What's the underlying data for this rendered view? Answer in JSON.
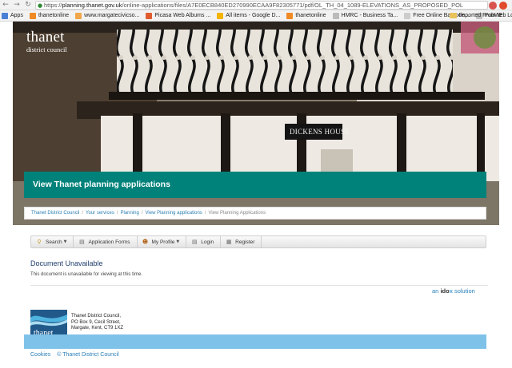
{
  "browser": {
    "url_scheme": "https://",
    "url_host": "planning.thanet.gov.uk",
    "url_path": "/online-applications/files/A7E0ECB840ED270990ECAA9F82305771/pdf/OL_TH_04_1089-ELEVATIONS_AS_PROPOSED_POL",
    "bookmarks": [
      {
        "label": "Apps",
        "color": "#4a7fd6"
      },
      {
        "label": "thanetonline",
        "color": "#f08a24"
      },
      {
        "label": "www.margatecivicso...",
        "color": "#f0a64a"
      },
      {
        "label": "Picasa Web Albums ...",
        "color": "#e05c2f"
      },
      {
        "label": "All items - Google D...",
        "color": "#f4b400"
      },
      {
        "label": "thanetonline",
        "color": "#f08a24"
      },
      {
        "label": "HMRC - Business Ta...",
        "color": "#bbbbbb"
      },
      {
        "label": "Free Online Barcode...",
        "color": "#cccccc"
      },
      {
        "label": "PubWeb Logon",
        "color": "#c0c0c0"
      }
    ],
    "bookmark_folder": "Imported From IE"
  },
  "brand": {
    "title": "thanet",
    "subtitle": "district council"
  },
  "hero": {
    "sign_text": "DICKENS HOUSE"
  },
  "banner": {
    "title": "View Thanet planning applications"
  },
  "breadcrumb": {
    "links": [
      "Thanet District Council",
      "Your services",
      "Planning",
      "View Planning applications"
    ],
    "current": "View Planning Applications"
  },
  "toolbar": {
    "items": [
      {
        "label": "Search",
        "icon": "search-icon",
        "dropdown": true
      },
      {
        "label": "Application Forms",
        "icon": "document-icon",
        "dropdown": false
      },
      {
        "label": "My Profile",
        "icon": "user-icon",
        "dropdown": true
      },
      {
        "label": "Login",
        "icon": "login-icon",
        "dropdown": false
      },
      {
        "label": "Register",
        "icon": "register-icon",
        "dropdown": false
      }
    ]
  },
  "content": {
    "heading": "Document Unavailable",
    "message": "This document is unavailable for viewing at this time."
  },
  "idox": {
    "prefix": "an",
    "brand_i": "id",
    "brand_o": "o",
    "brand_x": "x",
    "suffix": "solution"
  },
  "footer": {
    "logo_title": "thanet",
    "logo_subtitle": "district council",
    "address": [
      "Thanet District Council,",
      "PO Box 9, Cecil Street,",
      "Margate, Kent, CT9 1XZ"
    ],
    "links": [
      "Cookies",
      "© Thanet District Council"
    ]
  },
  "colors": {
    "banner": "#00827a",
    "footer_band": "#7fc2e9",
    "link": "#2a7fb8"
  }
}
